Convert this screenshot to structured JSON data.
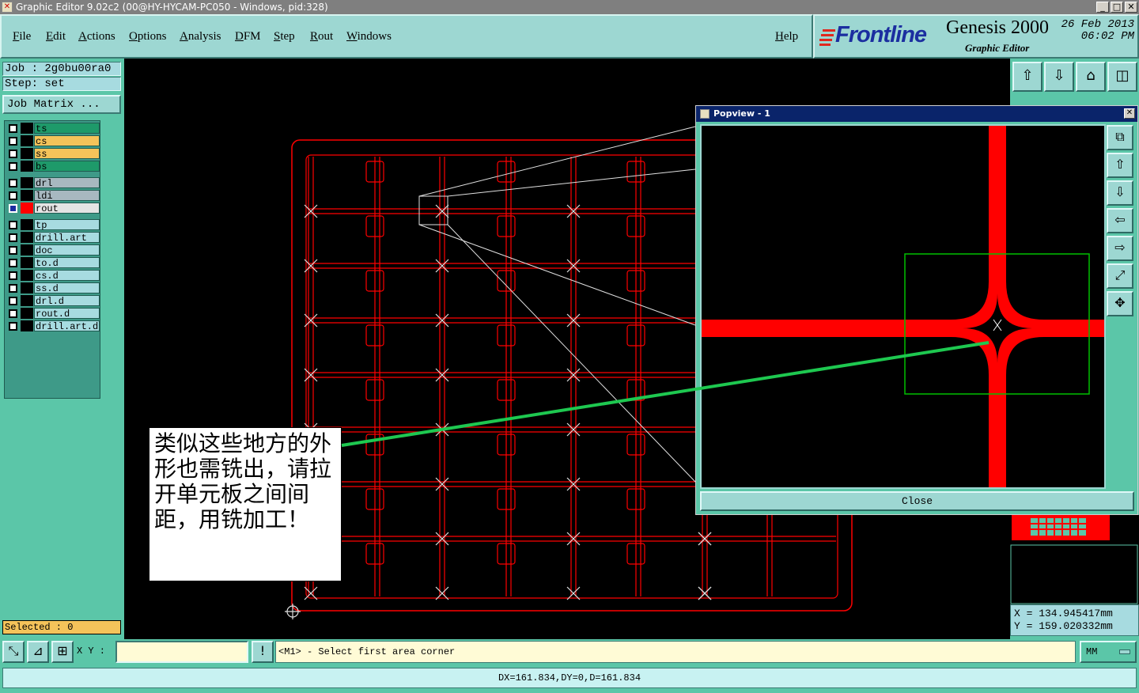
{
  "window": {
    "title": "Graphic Editor 9.02c2 (00@HY-HYCAM-PC050 - Windows, pid:328)",
    "min_label": "_",
    "max_label": "□",
    "close_label": "✕"
  },
  "menu": [
    "File",
    "Edit",
    "Actions",
    "Options",
    "Analysis",
    "DFM",
    "Step",
    "Rout",
    "Windows",
    "Help"
  ],
  "logo": {
    "brand": "Frontline",
    "product": "Genesis 2000",
    "subtitle": "Graphic Editor",
    "date": "26 Feb 2013",
    "time": "06:02 PM"
  },
  "job": {
    "job_line": "Job : 2g0bu00ra0",
    "step_line": "Step: set",
    "matrix_button": "Job Matrix ..."
  },
  "layers": [
    {
      "name": "ts",
      "color": "#1e9a6a",
      "swatch": "#000000",
      "active": false
    },
    {
      "name": "cs",
      "color": "#f4c35a",
      "swatch": "#000000",
      "active": false
    },
    {
      "name": "ss",
      "color": "#f4c35a",
      "swatch": "#000000",
      "active": false
    },
    {
      "name": "bs",
      "color": "#1e9a6a",
      "swatch": "#000000",
      "active": false
    },
    {
      "name": "drl",
      "color": "#a8b8c0",
      "swatch": "#000000",
      "active": false
    },
    {
      "name": "ldi",
      "color": "#a8b8c0",
      "swatch": "#000000",
      "active": false
    },
    {
      "name": "rout",
      "color": "#e4e4e4",
      "swatch": "#ff0000",
      "active": true
    },
    {
      "name": "tp",
      "color": "#a7dbe0",
      "swatch": "#000000",
      "active": false
    },
    {
      "name": "drill.art",
      "color": "#a7dbe0",
      "swatch": "#000000",
      "active": false
    },
    {
      "name": "doc",
      "color": "#a7dbe0",
      "swatch": "#000000",
      "active": false
    },
    {
      "name": "to.d",
      "color": "#a7dbe0",
      "swatch": "#000000",
      "active": false
    },
    {
      "name": "cs.d",
      "color": "#a7dbe0",
      "swatch": "#000000",
      "active": false
    },
    {
      "name": "ss.d",
      "color": "#a7dbe0",
      "swatch": "#000000",
      "active": false
    },
    {
      "name": "drl.d",
      "color": "#a7dbe0",
      "swatch": "#000000",
      "active": false
    },
    {
      "name": "rout.d",
      "color": "#a7dbe0",
      "swatch": "#000000",
      "active": false
    },
    {
      "name": "drill.art.d",
      "color": "#a7dbe0",
      "swatch": "#000000",
      "active": false
    }
  ],
  "selected_text": "Selected : 0",
  "popview": {
    "title": "Popview - 1",
    "close_label": "Close"
  },
  "note": "类似这些地方的外形也需铣出，请拉开单元板之间间距，用铣加工！",
  "coords": {
    "x": "X = 134.945417mm",
    "y": "Y = 159.020332mm"
  },
  "command": {
    "xy_label": "X Y :",
    "xy_value": "",
    "prompt": "<M1> - Select first area corner",
    "units": "MM",
    "info_icon": "!"
  },
  "status": "DX=161.834,DY=0,D=161.834",
  "colors": {
    "rout": "#ff0000",
    "panel": "#5bc6a8",
    "menu": "#9dd7d2",
    "highlight_box": "#00c000",
    "pointer_line": "#1ec850"
  }
}
